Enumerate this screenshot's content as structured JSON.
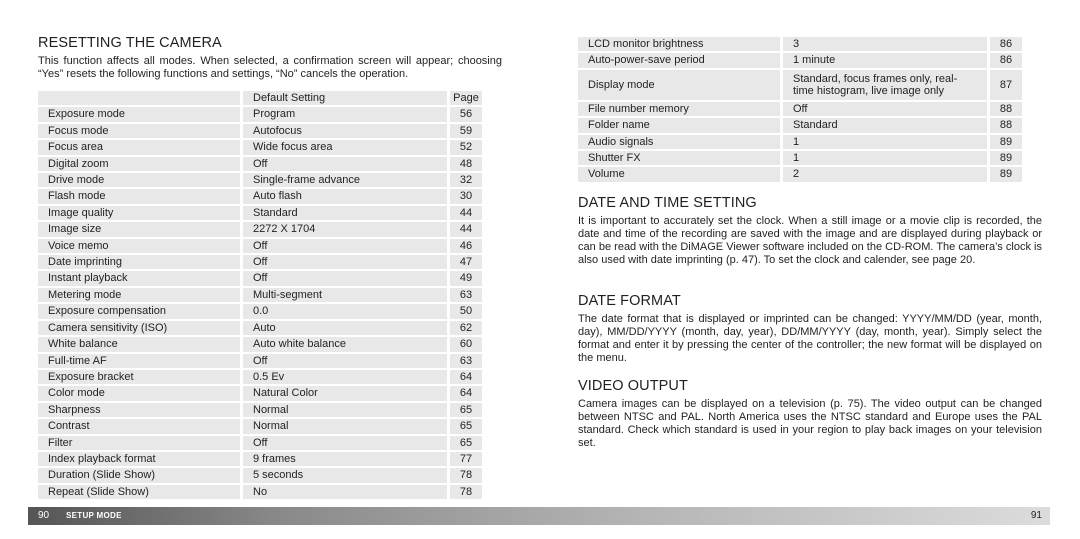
{
  "left": {
    "title": "RESETTING THE CAMERA",
    "intro": "This function affects all modes. When selected, a confirmation screen will appear; choosing “Yes” resets the following functions and settings, “No” cancels the operation.",
    "headers": [
      "",
      "Default Setting",
      "Page"
    ],
    "rows": [
      [
        "Exposure mode",
        "Program",
        "56"
      ],
      [
        "Focus mode",
        "Autofocus",
        "59"
      ],
      [
        "Focus area",
        "Wide focus area",
        "52"
      ],
      [
        "Digital zoom",
        "Off",
        "48"
      ],
      [
        "Drive mode",
        "Single-frame advance",
        "32"
      ],
      [
        "Flash mode",
        "Auto flash",
        "30"
      ],
      [
        "Image quality",
        "Standard",
        "44"
      ],
      [
        "Image size",
        "2272 X 1704",
        "44"
      ],
      [
        "Voice memo",
        "Off",
        "46"
      ],
      [
        "Date imprinting",
        "Off",
        "47"
      ],
      [
        "Instant playback",
        "Off",
        "49"
      ],
      [
        "Metering mode",
        "Multi-segment",
        "63"
      ],
      [
        "Exposure compensation",
        "0.0",
        "50"
      ],
      [
        "Camera sensitivity (ISO)",
        "Auto",
        "62"
      ],
      [
        "White balance",
        "Auto white balance",
        "60"
      ],
      [
        "Full-time AF",
        "Off",
        "63"
      ],
      [
        "Exposure bracket",
        "0.5 Ev",
        "64"
      ],
      [
        "Color mode",
        "Natural Color",
        "64"
      ],
      [
        "Sharpness",
        "Normal",
        "65"
      ],
      [
        "Contrast",
        "Normal",
        "65"
      ],
      [
        "Filter",
        "Off",
        "65"
      ],
      [
        "Index playback format",
        "9 frames",
        "77"
      ],
      [
        "Duration (Slide Show)",
        "5 seconds",
        "78"
      ],
      [
        "Repeat (Slide Show)",
        "No",
        "78"
      ]
    ]
  },
  "right": {
    "rows": [
      [
        "LCD monitor brightness",
        "3",
        "86"
      ],
      [
        "Auto-power-save period",
        "1 minute",
        "86"
      ],
      [
        "Display mode",
        "Standard, focus frames only, real-time histogram, live image only",
        "87"
      ],
      [
        "File number memory",
        "Off",
        "88"
      ],
      [
        "Folder name",
        "Standard",
        "88"
      ],
      [
        "Audio signals",
        "1",
        "89"
      ],
      [
        "Shutter FX",
        "1",
        "89"
      ],
      [
        "Volume",
        "2",
        "89"
      ]
    ],
    "sections": [
      {
        "title": "DATE AND TIME SETTING",
        "text": "It is important to accurately set the clock. When a still image or a movie clip is recorded, the date and time of the recording are saved with the image and are displayed during playback or can be read with the DiMAGE Viewer software included on the CD-ROM. The camera’s clock is also used with date imprinting (p. 47). To set the clock and calender, see page 20."
      },
      {
        "title": "DATE FORMAT",
        "text": "The date format that is displayed or imprinted can be changed: YYYY/MM/DD (year, month, day), MM/DD/YYYY (month, day, year), DD/MM/YYYY (day, month, year). Simply select the format and enter it by pressing the center of the controller; the new format will be displayed on the menu."
      },
      {
        "title": "VIDEO OUTPUT",
        "text": "Camera images can be displayed on a television (p. 75). The video output can be changed between NTSC and PAL. North America uses the NTSC standard and Europe uses the PAL standard. Check which standard is used in your region to play back images on your television set."
      }
    ]
  },
  "footer": {
    "left_page": "90",
    "section": "SETUP MODE",
    "right_page": "91"
  }
}
